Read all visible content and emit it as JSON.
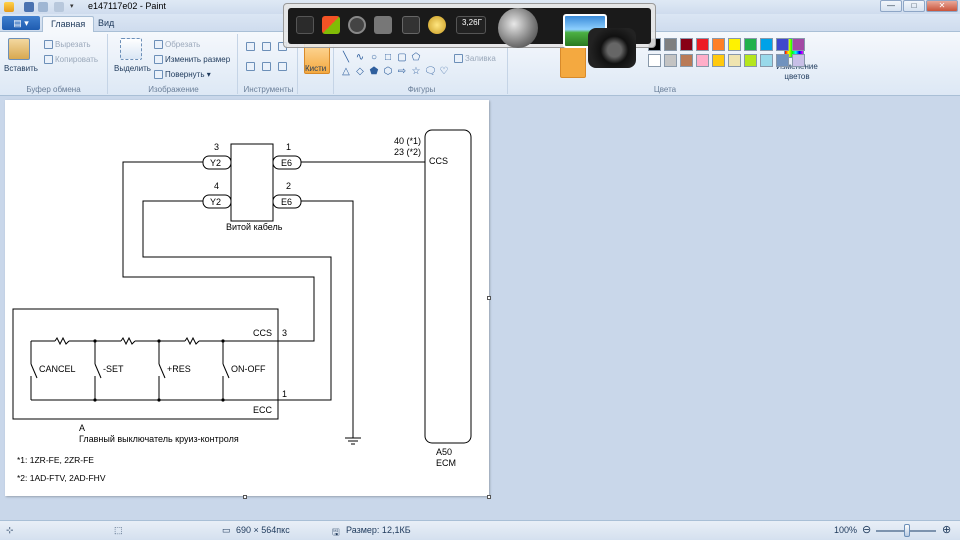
{
  "window": {
    "title": "e147117e02 - Paint",
    "minimize": "—",
    "maximize": "□",
    "close": "✕"
  },
  "tabs": {
    "menu": "▤ ▾",
    "home": "Главная",
    "view": "Вид"
  },
  "ribbon": {
    "clipboard": {
      "label": "Буфер обмена",
      "paste": "Вставить",
      "cut": "Вырезать",
      "copy": "Копировать"
    },
    "image": {
      "label": "Изображение",
      "select": "Выделить",
      "crop": "Обрезать",
      "resize": "Изменить размер",
      "rotate": "Повернуть"
    },
    "tools": {
      "label": "Инструменты"
    },
    "brushes": {
      "label": "Кисти"
    },
    "shapes": {
      "label": "Фигуры",
      "fill": "Заливка"
    },
    "colors": {
      "label": "Цвета",
      "edit": "Изменение цветов"
    },
    "palette_top": [
      "#000000",
      "#7f7f7f",
      "#880015",
      "#ed1c24",
      "#ff7f27",
      "#fff200",
      "#22b14c",
      "#00a2e8",
      "#3f48cc",
      "#a349a4"
    ],
    "palette_bottom": [
      "#ffffff",
      "#c3c3c3",
      "#b97a57",
      "#ffaec9",
      "#ffc90e",
      "#efe4b0",
      "#b5e61d",
      "#99d9ea",
      "#7092be",
      "#c8bfe7"
    ]
  },
  "taskbar": {
    "disk_label": "3,26Г"
  },
  "diagram": {
    "pin_3": "3",
    "pin_4": "4",
    "pin_1": "1",
    "pin_2": "2",
    "conn_y2a": "Y2",
    "conn_y2b": "Y2",
    "conn_e6a": "E6",
    "conn_e6b": "E6",
    "spiral_cable": "Витой кабель",
    "ecm_pin_a": "40 (*1)",
    "ecm_pin_b": "23 (*2)",
    "ecm_ccs": "CCS",
    "ecm_code": "A50",
    "ecm_name": "ECM",
    "switch_ccs": "CCS",
    "switch_ccs_pin": "3",
    "switch_ecc": "ECC",
    "switch_ecc_pin": "1",
    "sw_cancel": "CANCEL",
    "sw_set": "-SET",
    "sw_res": "+RES",
    "sw_onoff": "ON-OFF",
    "switch_code": "A",
    "switch_name": "Главный выключатель круиз-контроля",
    "note_1": "*1: 1ZR-FE, 2ZR-FE",
    "note_2": "*2: 1AD-FTV, 2AD-FHV"
  },
  "status": {
    "dimensions": "690 × 564пкс",
    "size": "Размер: 12,1КБ",
    "zoom": "100%"
  }
}
